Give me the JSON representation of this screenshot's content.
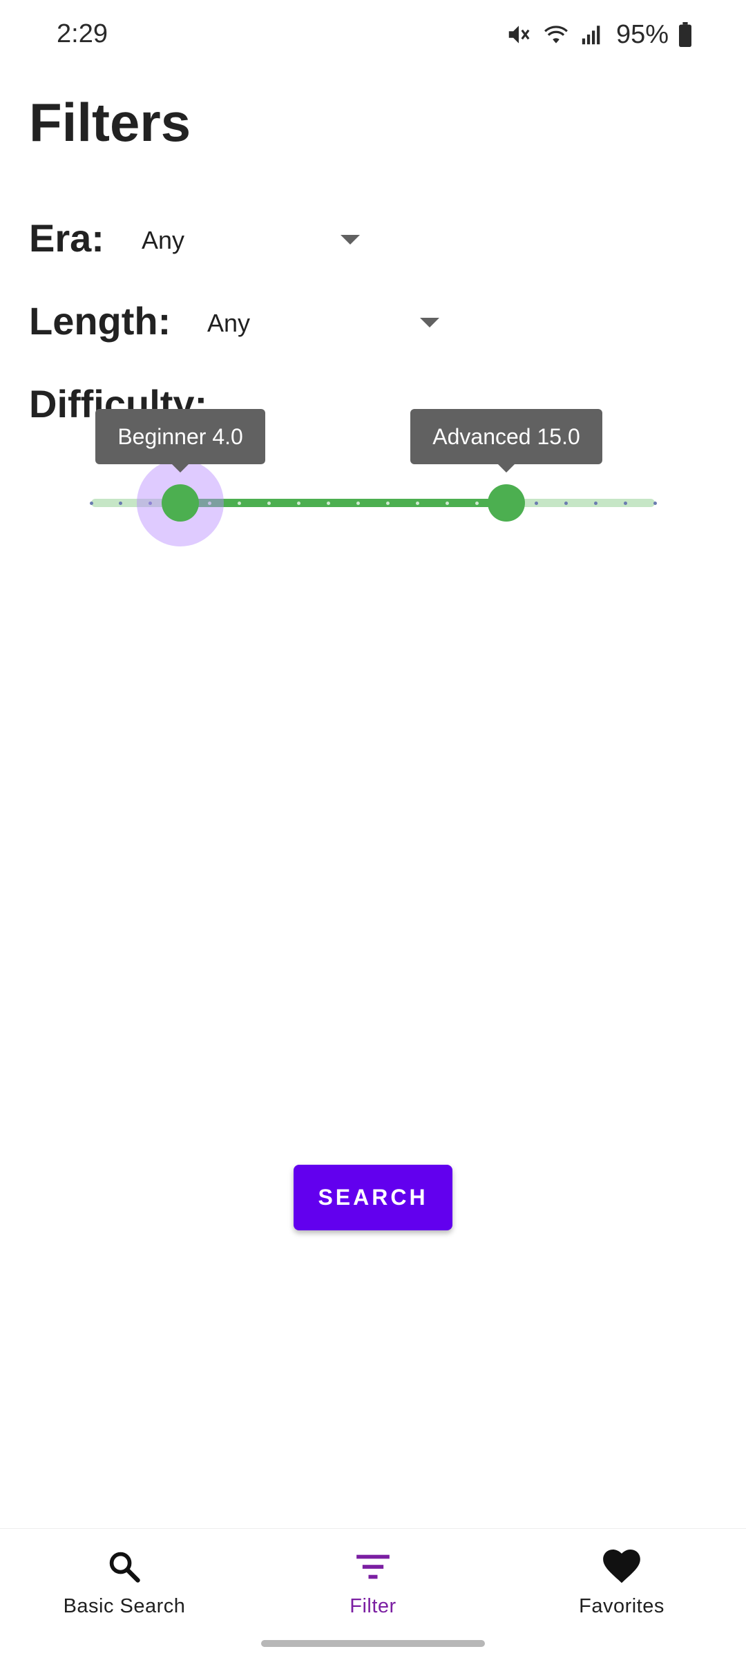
{
  "status_bar": {
    "time": "2:29",
    "battery": "95%",
    "icons": [
      "mute-icon",
      "wifi-icon",
      "signal-icon",
      "battery-icon"
    ]
  },
  "page": {
    "title": "Filters"
  },
  "filters": {
    "era": {
      "label": "Era:",
      "value": "Any"
    },
    "length": {
      "label": "Length:",
      "value": "Any"
    },
    "difficulty": {
      "label": "Difficulty:",
      "min": 1,
      "max": 20,
      "lower": {
        "tooltip": "Beginner 4.0",
        "value": 4.0
      },
      "upper": {
        "tooltip": "Advanced 15.0",
        "value": 15.0
      }
    }
  },
  "actions": {
    "search_label": "SEARCH"
  },
  "bottom_nav": {
    "items": [
      {
        "label": "Basic Search",
        "icon": "search-icon"
      },
      {
        "label": "Filter",
        "icon": "filter-icon",
        "active": true
      },
      {
        "label": "Favorites",
        "icon": "heart-icon"
      }
    ]
  },
  "colors": {
    "accent": "#6200ee",
    "active_nav": "#7b1fa2",
    "slider_green": "#4caf50",
    "tooltip_gray": "#616161"
  }
}
